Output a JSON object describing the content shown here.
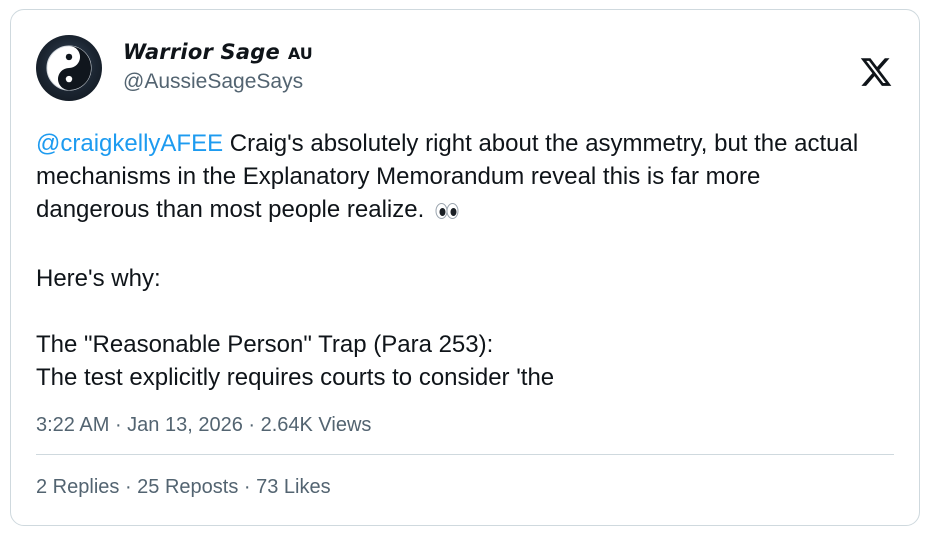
{
  "author": {
    "display_name": "Warrior Sage",
    "badge": "AU",
    "handle": "@AussieSageSays",
    "avatar_icon": "yin-yang-icon"
  },
  "platform_icon": "x-logo-icon",
  "tweet": {
    "mention": "@craigkellyAFEE",
    "line1": " Craig's absolutely right about the asymmetry, but the actual",
    "line2": "mechanisms in the Explanatory Memorandum reveal this is far more",
    "line3": "dangerous than most people realize.",
    "emoji": "eyes-emoji",
    "line4": "Here's why:",
    "line5": "The \"Reasonable Person\" Trap (Para 253):",
    "line6": "The test explicitly requires courts to consider 'the"
  },
  "meta": {
    "time": "3:22 AM",
    "date": "Jan 13, 2026",
    "views": "2.64K Views",
    "separator": " · "
  },
  "stats": {
    "replies": "2 Replies",
    "reposts": "25 Reposts",
    "likes": "73 Likes",
    "separator": " · "
  },
  "colors": {
    "mention": "#1d9bf0",
    "muted": "#536471",
    "text": "#0f1419",
    "border": "#cfd9de"
  }
}
